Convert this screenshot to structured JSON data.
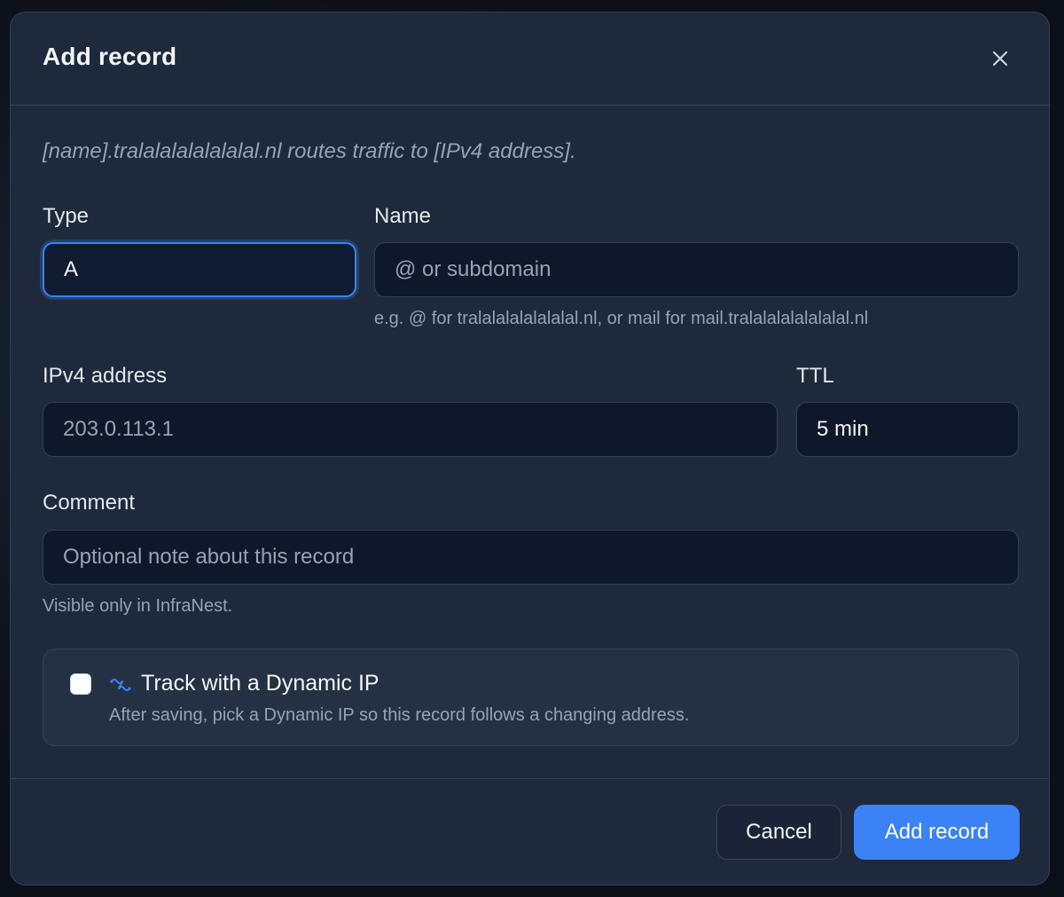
{
  "dialog": {
    "title": "Add record",
    "hint": "[name].tralalalalalalalal.nl routes traffic to [IPv4 address]."
  },
  "fields": {
    "type": {
      "label": "Type",
      "value": "A"
    },
    "name": {
      "label": "Name",
      "value": "",
      "placeholder": "@ or subdomain",
      "help": "e.g. @ for tralalalalalalalal.nl, or mail for mail.tralalalalalalalal.nl"
    },
    "ipv4": {
      "label": "IPv4 address",
      "value": "",
      "placeholder": "203.0.113.1"
    },
    "ttl": {
      "label": "TTL",
      "value": "5 min"
    },
    "comment": {
      "label": "Comment",
      "value": "",
      "placeholder": "Optional note about this record",
      "help": "Visible only in InfraNest."
    }
  },
  "dynamic_ip": {
    "checked": false,
    "title": "Track with a Dynamic IP",
    "description": "After saving, pick a Dynamic IP so this record follows a changing address.",
    "icon": "dynamic-ip-icon"
  },
  "footer": {
    "cancel_label": "Cancel",
    "submit_label": "Add record"
  },
  "colors": {
    "accent": "#3b82f6",
    "surface": "#1e293b",
    "input_bg": "#0f172a"
  }
}
